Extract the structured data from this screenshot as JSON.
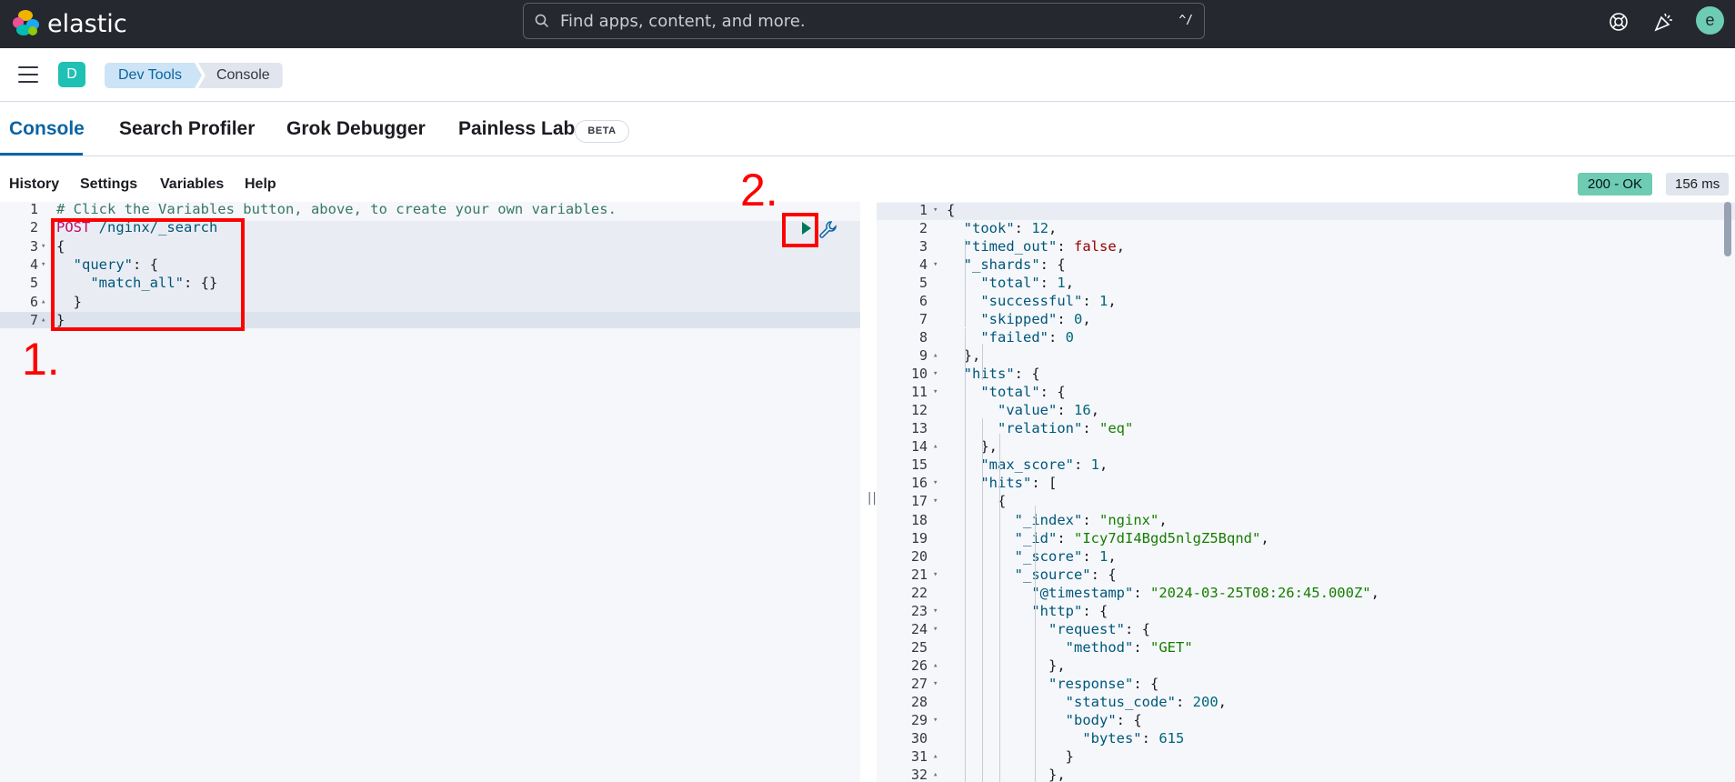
{
  "header": {
    "logo_text": "elastic",
    "search_placeholder": "Find apps, content, and more.",
    "search_shortcut": "^/",
    "avatar_letter": "e"
  },
  "subbar": {
    "space_letter": "D",
    "breadcrumbs": [
      "Dev Tools",
      "Console"
    ]
  },
  "tabs": [
    {
      "label": "Console",
      "active": true
    },
    {
      "label": "Search Profiler"
    },
    {
      "label": "Grok Debugger"
    },
    {
      "label": "Painless Lab"
    }
  ],
  "beta_badge": "BETA",
  "actions": [
    "History",
    "Settings",
    "Variables",
    "Help"
  ],
  "status": {
    "code": "200 - OK",
    "time": "156 ms"
  },
  "annotations": [
    "1.",
    "2."
  ],
  "editor": {
    "lines": [
      "# Click the Variables button, above, to create your own variables.",
      "POST /nginx/_search",
      "{",
      "  \"query\": {",
      "    \"match_all\": {}",
      "  }",
      "}"
    ]
  },
  "output": {
    "lines": [
      "{",
      "  \"took\": 12,",
      "  \"timed_out\": false,",
      "  \"_shards\": {",
      "    \"total\": 1,",
      "    \"successful\": 1,",
      "    \"skipped\": 0,",
      "    \"failed\": 0",
      "  },",
      "  \"hits\": {",
      "    \"total\": {",
      "      \"value\": 16,",
      "      \"relation\": \"eq\"",
      "    },",
      "    \"max_score\": 1,",
      "    \"hits\": [",
      "      {",
      "        \"_index\": \"nginx\",",
      "        \"_id\": \"Icy7dI4Bgd5nlgZ5Bqnd\",",
      "        \"_score\": 1,",
      "        \"_source\": {",
      "          \"@timestamp\": \"2024-03-25T08:26:45.000Z\",",
      "          \"http\": {",
      "            \"request\": {",
      "              \"method\": \"GET\"",
      "            },",
      "            \"response\": {",
      "              \"status_code\": 200,",
      "              \"body\": {",
      "                \"bytes\": 615",
      "              }",
      "            },"
    ]
  },
  "colors": {
    "header_bg": "#25282f",
    "accent": "#0b64a3",
    "success": "#6dccb1",
    "annotation": "#ff0000"
  }
}
